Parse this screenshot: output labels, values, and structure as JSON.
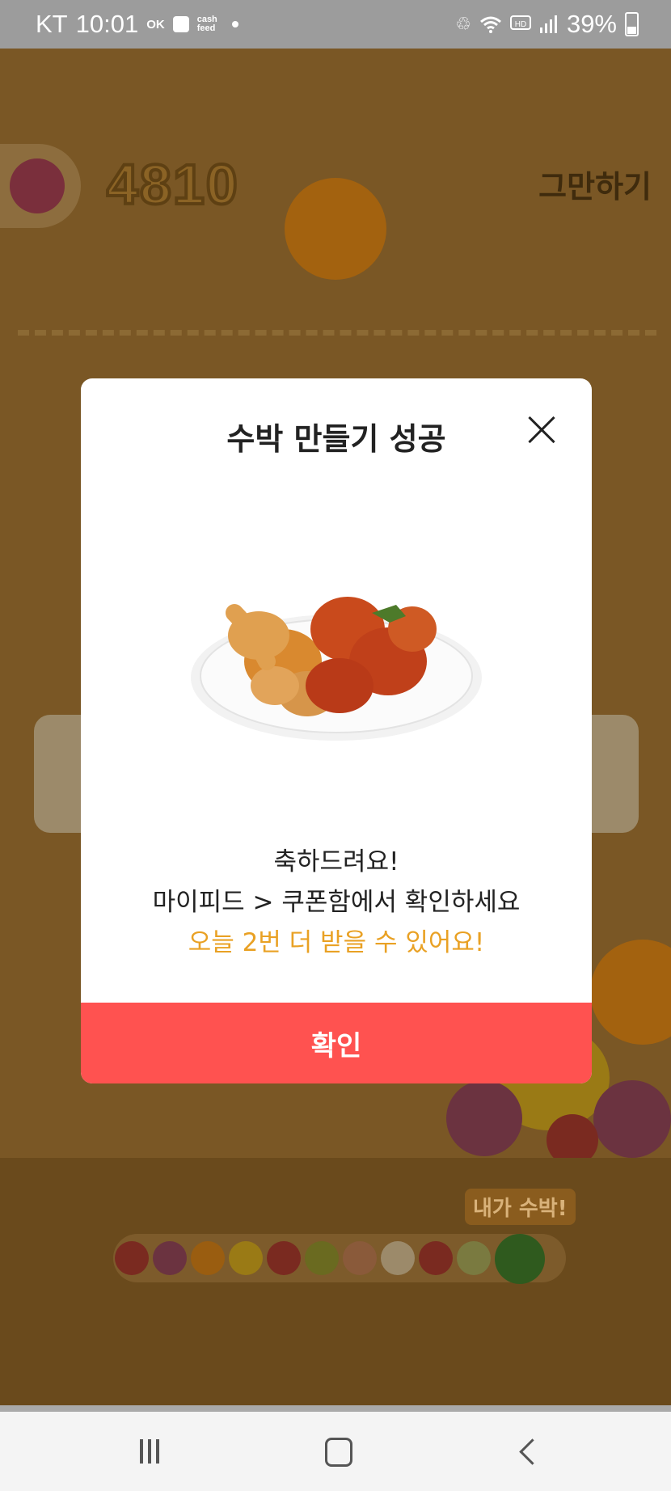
{
  "status_bar": {
    "carrier": "KT",
    "time": "10:01",
    "app_icon_1": "OK",
    "app_icon_2_line1": "cash",
    "app_icon_2_line2": "feed",
    "battery": "39%",
    "icons": [
      "ok-cashbag-icon",
      "app-icon",
      "cashfeed-icon",
      "notification-dot",
      "wifi-icon",
      "hd-voice-icon",
      "signal-icon",
      "battery-icon"
    ]
  },
  "game": {
    "score": "4810",
    "quit_label": "그만하기",
    "target_tag": "내가 수박!"
  },
  "modal": {
    "title": "수박 만들기 성공",
    "message_line1": "축하드려요!",
    "message_line2": "마이피드 > 쿠폰함에서 확인하세요",
    "message_line3": "오늘 2번 더 받을 수 있어요!",
    "confirm_label": "확인",
    "image": "fried-chicken-plate"
  },
  "colors": {
    "confirm_button": "#ff5250",
    "highlight_text": "#e9a124",
    "overlay_bg": "#7a5725"
  },
  "nav": {
    "icons": [
      "recent-apps-icon",
      "home-icon",
      "back-icon"
    ]
  }
}
